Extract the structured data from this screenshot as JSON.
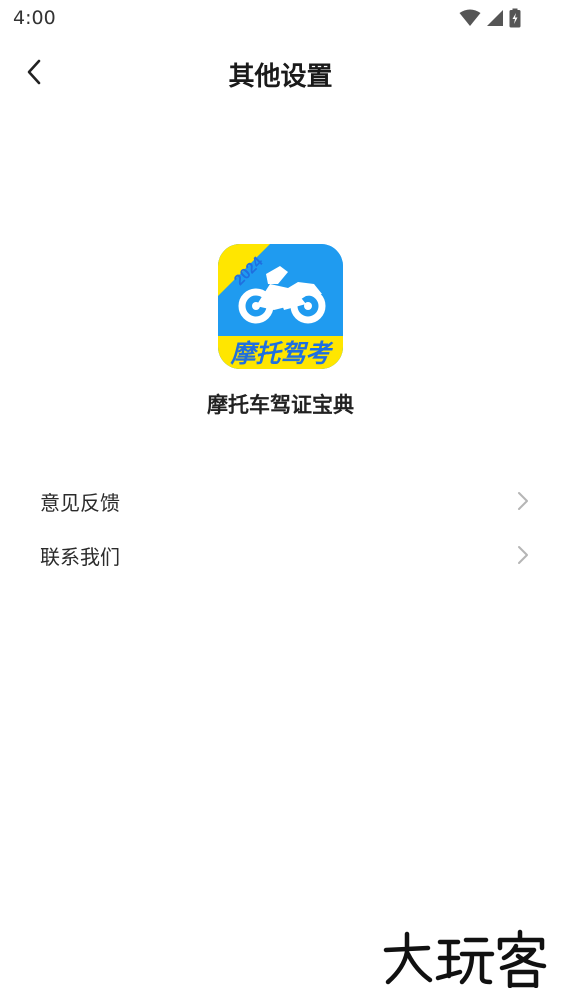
{
  "status_bar": {
    "time": "4:00",
    "icons": [
      "wifi-icon",
      "signal-icon",
      "battery-icon"
    ]
  },
  "header": {
    "back_icon": "chevron-left-icon",
    "title": "其他设置"
  },
  "app": {
    "icon_year": "2024",
    "icon_text": "摩托驾考",
    "name": "摩托车驾证宝典",
    "colors": {
      "icon_bg": "#1f9bf0",
      "icon_band": "#ffe600",
      "icon_text": "#1f6fe0"
    }
  },
  "menu": {
    "items": [
      {
        "label": "意见反馈",
        "icon": "chevron-right-icon"
      },
      {
        "label": "联系我们",
        "icon": "chevron-right-icon"
      }
    ]
  },
  "watermark": {
    "text": "大玩客"
  }
}
